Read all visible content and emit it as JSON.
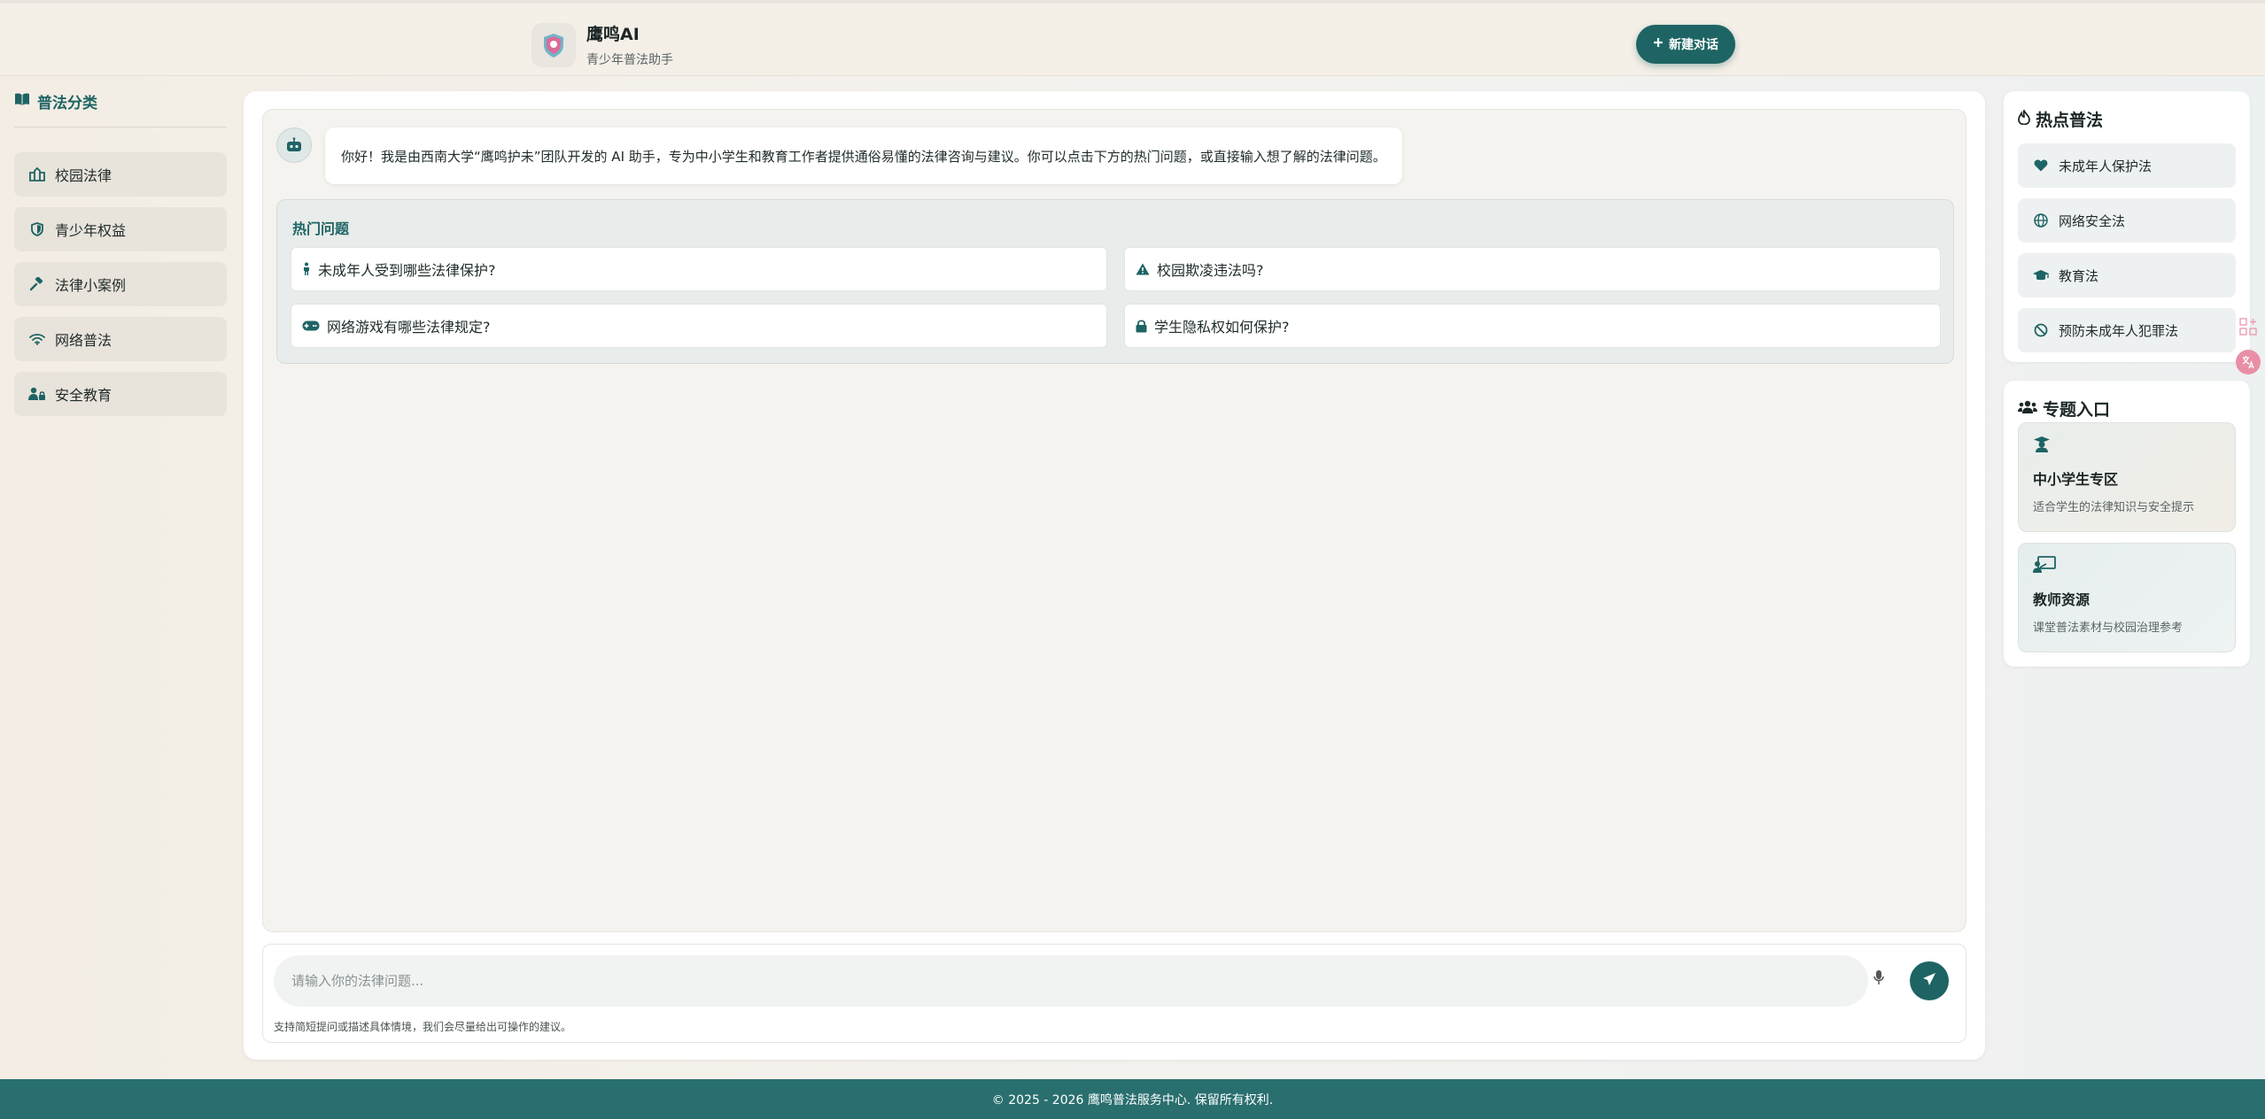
{
  "header": {
    "app_name": "鹰鸣AI",
    "app_subtitle": "青少年普法助手",
    "new_chat_label": "新建对话"
  },
  "sidebar": {
    "title": "普法分类",
    "items": [
      {
        "label": "校园法律",
        "icon": "school-icon"
      },
      {
        "label": "青少年权益",
        "icon": "shield-icon"
      },
      {
        "label": "法律小案例",
        "icon": "gavel-icon"
      },
      {
        "label": "网络普法",
        "icon": "wifi-icon"
      },
      {
        "label": "安全教育",
        "icon": "user-lock-icon"
      }
    ]
  },
  "chat": {
    "welcome": "你好！我是由西南大学“鹰鸣护未”团队开发的 AI 助手，专为中小学生和教育工作者提供通俗易懂的法律咨询与建议。你可以点击下方的热门问题，或直接输入想了解的法律问题。",
    "hot_title": "热门问题",
    "questions": [
      {
        "label": "未成年人受到哪些法律保护?",
        "icon": "child-icon"
      },
      {
        "label": "校园欺凌违法吗?",
        "icon": "warning-icon"
      },
      {
        "label": "网络游戏有哪些法律规定?",
        "icon": "gamepad-icon"
      },
      {
        "label": "学生隐私权如何保护?",
        "icon": "lock-icon"
      }
    ]
  },
  "input": {
    "placeholder": "请输入你的法律问题...",
    "hint": "支持简短提问或描述具体情境，我们会尽量给出可操作的建议。"
  },
  "hot_laws": {
    "title": "热点普法",
    "items": [
      {
        "label": "未成年人保护法",
        "icon": "heart-icon"
      },
      {
        "label": "网络安全法",
        "icon": "globe-icon"
      },
      {
        "label": "教育法",
        "icon": "graduation-cap-icon"
      },
      {
        "label": "预防未成年人犯罪法",
        "icon": "ban-icon"
      }
    ]
  },
  "topics": {
    "title": "专题入口",
    "items": [
      {
        "title": "中小学生专区",
        "desc": "适合学生的法律知识与安全提示",
        "icon": "student-icon"
      },
      {
        "title": "教师资源",
        "desc": "课堂普法素材与校园治理参考",
        "icon": "teacher-icon"
      }
    ]
  },
  "footer": {
    "text": "© 2025 - 2026 鹰鸣普法服务中心. 保留所有权利."
  },
  "colors": {
    "accent": "#1e6464",
    "footer": "#2a6f6f"
  }
}
